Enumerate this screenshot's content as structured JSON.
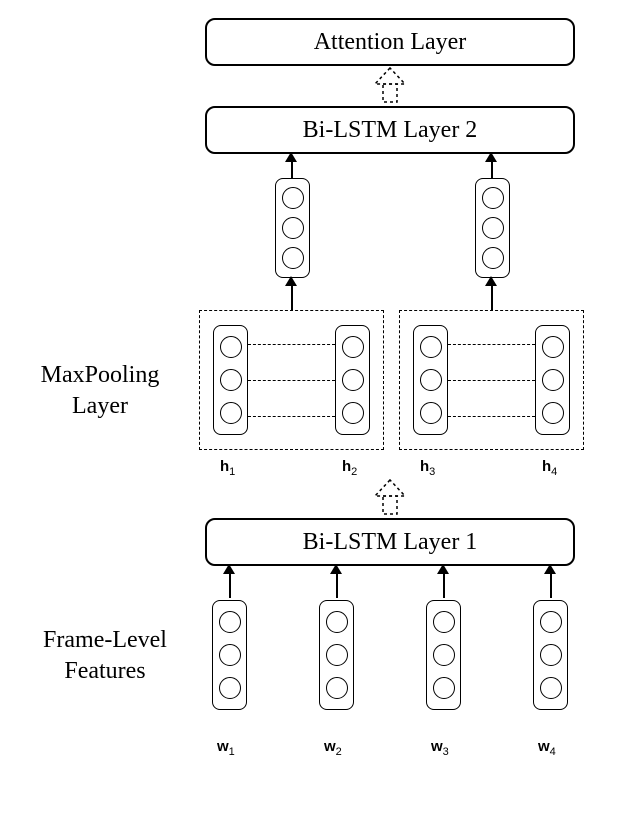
{
  "layers": {
    "attention": "Attention Layer",
    "bilstm2": "Bi-LSTM Layer 2",
    "bilstm1": "Bi-LSTM Layer 1"
  },
  "side_labels": {
    "maxpool_line1": "MaxPooling",
    "maxpool_line2": "Layer",
    "framefeat_line1": "Frame-Level",
    "framefeat_line2": "Features"
  },
  "h_labels": [
    "h",
    "h",
    "h",
    "h"
  ],
  "h_subs": [
    "1",
    "2",
    "3",
    "4"
  ],
  "w_labels": [
    "w",
    "w",
    "w",
    "w"
  ],
  "w_subs": [
    "1",
    "2",
    "3",
    "4"
  ]
}
